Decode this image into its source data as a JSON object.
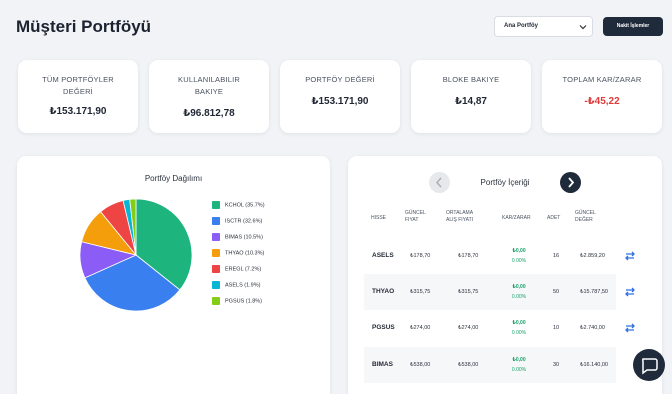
{
  "header": {
    "title": "Müşteri Portföyü",
    "portfolio_select": "Ana Portföy",
    "cash_button": "Nakit İşlemler"
  },
  "stats": [
    {
      "label": "TÜM PORTFÖYLER DEĞERİ",
      "value": "₺153.171,90"
    },
    {
      "label": "KULLANILABILIR BAKIYE",
      "value": "₺96.812,78"
    },
    {
      "label": "PORTFÖY DEĞERİ",
      "value": "₺153.171,90"
    },
    {
      "label": "BLOKE BAKIYE",
      "value": "₺14,87"
    },
    {
      "label": "TOPLAM KAR/ZARAR",
      "value": "-₺45,22"
    }
  ],
  "distribution": {
    "title": "Portföy Dağılımı",
    "legend": [
      {
        "label": "KCHOL (35.7%)",
        "color": "#1db47e"
      },
      {
        "label": "ISCTR (32.6%)",
        "color": "#3a7ff0"
      },
      {
        "label": "BIMAS (10.5%)",
        "color": "#8b5cf6"
      },
      {
        "label": "THYAO (10.3%)",
        "color": "#f59e0b"
      },
      {
        "label": "EREGL (7.2%)",
        "color": "#ef4444"
      },
      {
        "label": "ASELS (1.9%)",
        "color": "#06b6d4"
      },
      {
        "label": "PGSUS (1.8%)",
        "color": "#84cc16"
      }
    ]
  },
  "chart_data": {
    "type": "pie",
    "title": "Portföy Dağılımı",
    "categories": [
      "KCHOL",
      "ISCTR",
      "BIMAS",
      "THYAO",
      "EREGL",
      "ASELS",
      "PGSUS"
    ],
    "values": [
      35.7,
      32.6,
      10.5,
      10.3,
      7.2,
      1.9,
      1.8
    ],
    "colors": [
      "#1db47e",
      "#3a7ff0",
      "#8b5cf6",
      "#f59e0b",
      "#ef4444",
      "#06b6d4",
      "#84cc16"
    ],
    "legend_position": "right"
  },
  "holdings": {
    "title": "Portföy İçeriği",
    "prev_icon": "chevron-left-icon",
    "next_icon": "chevron-right-icon",
    "columns": [
      "HISSE",
      "GÜNCEL FIYAT",
      "ORTALAMA ALIŞ FIYATI",
      "KAR/ZARAR",
      "ADET",
      "GÜNCEL DEĞER"
    ],
    "rows": [
      {
        "symbol": "ASELS",
        "price": "₺178,70",
        "avg": "₺178,70",
        "pl": "₺0,00",
        "pl_pct": "0.00%",
        "qty": "16",
        "value": "₺2.859,20"
      },
      {
        "symbol": "THYAO",
        "price": "₺315,75",
        "avg": "₺315,75",
        "pl": "₺0,00",
        "pl_pct": "0.00%",
        "qty": "50",
        "value": "₺15.787,50"
      },
      {
        "symbol": "PGSUS",
        "price": "₺274,00",
        "avg": "₺274,00",
        "pl": "₺0,00",
        "pl_pct": "0.00%",
        "qty": "10",
        "value": "₺2.740,00"
      },
      {
        "symbol": "BIMAS",
        "price": "₺538,00",
        "avg": "₺538,00",
        "pl": "₺0,00",
        "pl_pct": "0.00%",
        "qty": "30",
        "value": "₺16.140,00"
      }
    ]
  }
}
